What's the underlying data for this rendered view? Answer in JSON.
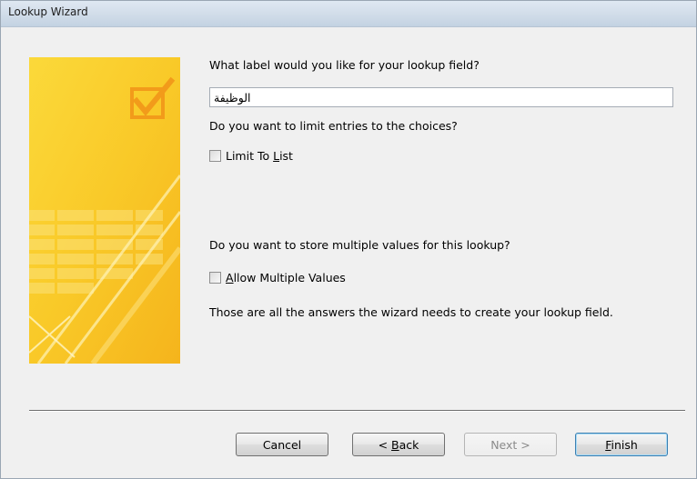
{
  "window": {
    "title": "Lookup Wizard"
  },
  "questions": {
    "label_prompt": "What label would you like for your lookup field?",
    "limit_prompt": "Do you want to limit entries to the choices?",
    "multi_prompt": "Do you want to store multiple values for this lookup?",
    "final_text": "Those are all the answers the wizard needs to create your lookup field."
  },
  "label_field": {
    "value": "الوظيفة",
    "placeholder": ""
  },
  "options": {
    "limit_to_list": {
      "label_pre": "Limit To ",
      "label_mnemonic": "L",
      "label_post": "ist",
      "checked": false
    },
    "allow_multiple": {
      "label_pre": "",
      "label_mnemonic": "A",
      "label_post": "llow Multiple Values",
      "checked": false
    }
  },
  "buttons": {
    "cancel": {
      "label": "Cancel"
    },
    "back": {
      "pre": "< ",
      "mnemonic": "B",
      "post": "ack"
    },
    "next": {
      "label": "Next >",
      "enabled": false
    },
    "finish": {
      "mnemonic": "F",
      "post": "inish"
    }
  },
  "colors": {
    "banner_yellow": "#f9cf2a",
    "banner_orange": "#f3a81b",
    "title_bar": "#cfdbe8"
  }
}
